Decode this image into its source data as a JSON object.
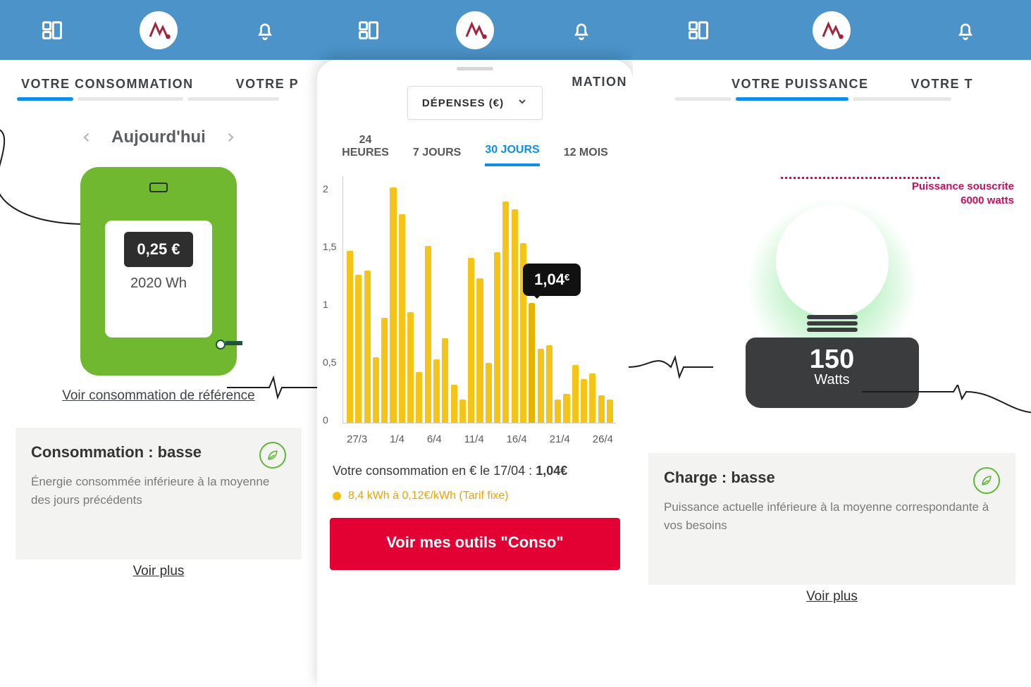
{
  "nav": {
    "dash": "dashboard",
    "bell": "alerts"
  },
  "panel1": {
    "tabs": [
      "VOTRE CONSOMMATION",
      "VOTRE P"
    ],
    "activeTab": 0,
    "date_label": "Aujourd'hui",
    "meter": {
      "price": "0,25 €",
      "wh": "2020 Wh"
    },
    "ref_link": "Voir consommation de référence",
    "card": {
      "title": "Consommation : basse",
      "body": "Énergie consommée inférieure à la moyenne des jours précédents"
    },
    "more": "Voir plus"
  },
  "panel2": {
    "tab_partial": "MATION",
    "dropdown_label": "DÉPENSES (€)",
    "range_tabs": [
      "24\nHEURES",
      "7 JOURS",
      "30 JOURS",
      "12 MOIS"
    ],
    "range_active": 2,
    "tooltip": {
      "value": "1,04",
      "currency": "€"
    },
    "caption_prefix": "Votre consommation en € le 17/04 : ",
    "caption_value": "1,04€",
    "tarif": "8,4 kWh à 0,12€/kWh (Tarif fixe)",
    "cta": "Voir mes outils \"Conso\""
  },
  "panel3": {
    "tabs": [
      "VOTRE PUISSANCE",
      "VOTRE T"
    ],
    "activeTab": 0,
    "subscribed_label": "Puissance souscrite",
    "subscribed_value": "6000 watts",
    "power_value": "150",
    "power_unit": "Watts",
    "card": {
      "title": "Charge : basse",
      "body": "Puissance actuelle inférieure à la moyenne correspondante à vos besoins"
    },
    "more": "Voir plus"
  },
  "chart_data": {
    "type": "bar",
    "title": "Dépenses (€) — 30 jours",
    "xlabel": "",
    "ylabel": "€",
    "ylim": [
      0,
      2.1
    ],
    "yticks": [
      0,
      0.5,
      1,
      1.5,
      2
    ],
    "categories": [
      "27/3",
      "28/3",
      "29/3",
      "30/3",
      "31/3",
      "1/4",
      "2/4",
      "3/4",
      "4/4",
      "5/4",
      "6/4",
      "7/4",
      "8/4",
      "9/4",
      "10/4",
      "11/4",
      "12/4",
      "13/4",
      "14/4",
      "15/4",
      "16/4",
      "17/4",
      "18/4",
      "19/4",
      "20/4",
      "21/4",
      "22/4",
      "23/4",
      "24/4",
      "25/4",
      "26/4"
    ],
    "xlabels_shown": [
      "27/3",
      "1/4",
      "6/4",
      "11/4",
      "16/4",
      "21/4",
      "26/4"
    ],
    "values": [
      1.49,
      1.28,
      1.32,
      0.57,
      0.91,
      2.04,
      1.81,
      0.96,
      0.44,
      1.53,
      0.55,
      0.73,
      0.33,
      0.2,
      1.43,
      1.25,
      0.52,
      1.48,
      1.92,
      1.85,
      1.56,
      1.04,
      0.64,
      0.67,
      0.2,
      0.25,
      0.5,
      0.38,
      0.43,
      0.24,
      0.2
    ],
    "highlight_index": 21,
    "highlight_value": 1.04
  }
}
